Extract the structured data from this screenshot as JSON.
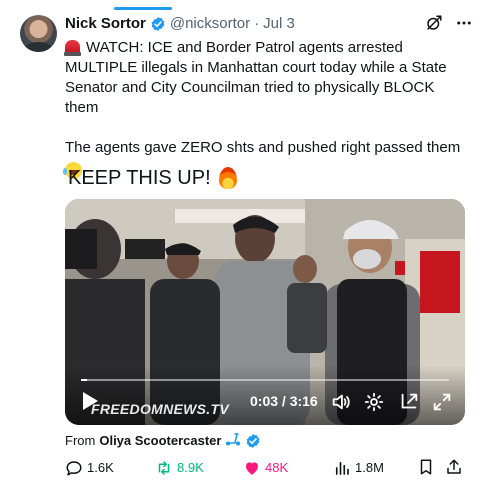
{
  "author": {
    "display_name": "Nick Sortor",
    "handle": "@nicksortor",
    "dot": "·",
    "date": "Jul 3"
  },
  "tweet": {
    "line1": "WATCH: ICE and Border Patrol agents arrested MULTIPLE illegals in Manhattan court today while a State Senator and City Councilman tried to physically BLOCK them",
    "line2": "The agents gave ZERO shts and pushed right passed them",
    "line3": "KEEP THIS UP!"
  },
  "video": {
    "watermark": "FREEDOMNEWS.TV",
    "time_display": "0:03 / 3:16",
    "progress_fraction": 0.016
  },
  "attribution": {
    "prefix": "From",
    "source_name": "Oliya Scootercaster"
  },
  "engagement": {
    "replies": "1.6K",
    "retweets": "8.9K",
    "likes": "48K",
    "views": "1.8M"
  },
  "colors": {
    "accent": "#1d9bf0",
    "retweet": "#00ba7c",
    "like": "#f91880",
    "muted": "#536471"
  },
  "icons": {
    "verified": "verified-badge-icon",
    "grok": "grok-icon",
    "more": "more-horizontal-icon",
    "reply": "reply-icon",
    "retweet": "retweet-icon",
    "like": "heart-icon",
    "views": "views-icon",
    "bookmark": "bookmark-icon",
    "share": "share-icon"
  }
}
